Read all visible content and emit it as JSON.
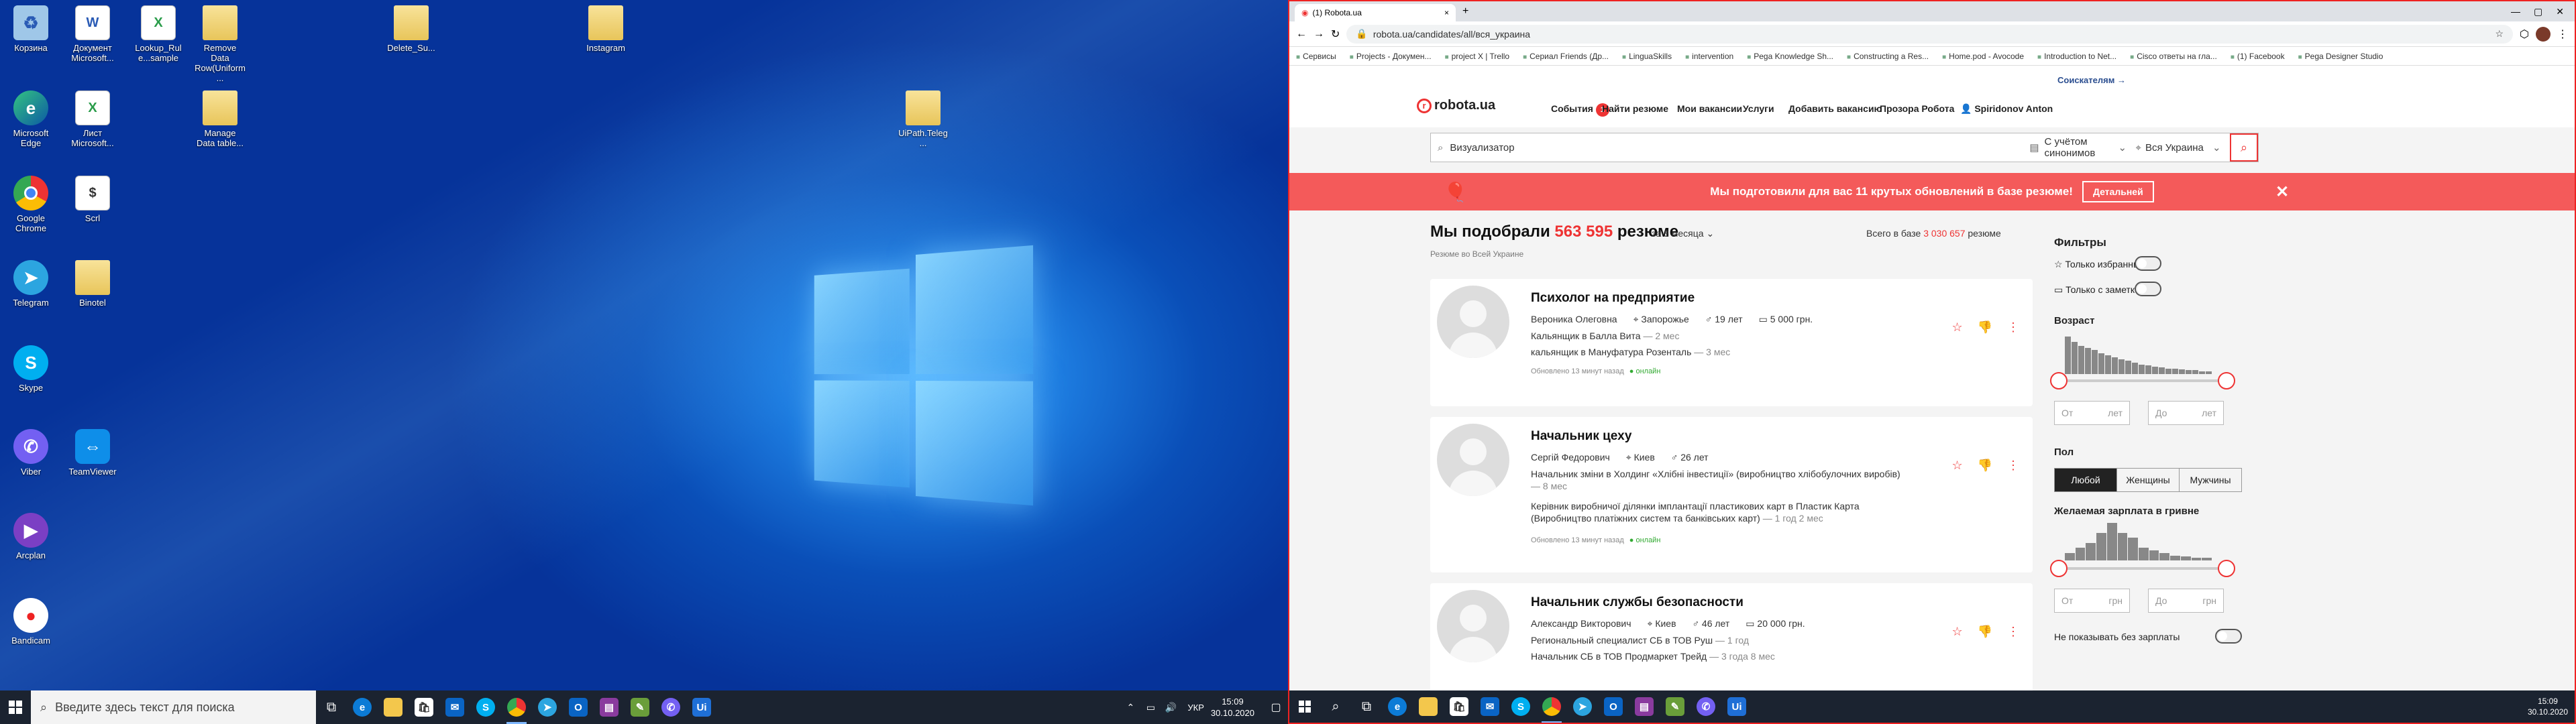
{
  "desktop": {
    "icons": [
      {
        "label": "Корзина",
        "type": "recycle"
      },
      {
        "label": "Документ Microsoft...",
        "type": "doc"
      },
      {
        "label": "Lookup_Rule...sample",
        "type": "doc"
      },
      {
        "label": "Remove Data Row(Uniform...",
        "type": "folder"
      },
      {
        "label": "Delete_Su...",
        "type": "folder"
      },
      {
        "label": "Instagram",
        "type": "folder"
      },
      {
        "label": "Microsoft Edge",
        "type": "edge"
      },
      {
        "label": "Лист Microsoft...",
        "type": "doc"
      },
      {
        "label": "Manage Data table...",
        "type": "folder"
      },
      {
        "label": "UiPath.Teleg...",
        "type": "folder"
      },
      {
        "label": "Google Chrome",
        "type": "chrome"
      },
      {
        "label": "Scrl",
        "type": "doc"
      },
      {
        "label": "Telegram",
        "type": "telegram"
      },
      {
        "label": "Binotel",
        "type": "folder"
      },
      {
        "label": "Skype",
        "type": "skype"
      },
      {
        "label": "Viber",
        "type": "viber"
      },
      {
        "label": "TeamViewer",
        "type": "teamviewer"
      },
      {
        "label": "Arcplan",
        "type": "app"
      },
      {
        "label": "Bandicam",
        "type": "bandicam"
      }
    ]
  },
  "taskbar": {
    "search_placeholder": "Введите здесь текст для поиска",
    "lang": "УКР",
    "time": "15:09",
    "date": "30.10.2020"
  },
  "browser": {
    "tab_title": "(1) Robota.ua",
    "url": "robota.ua/candidates/all/вся_украина",
    "bookmarks": [
      "Сервисы",
      "Projects - Докумен...",
      "project X | Trello",
      "Сериал Friends (Др...",
      "LinguaSkills",
      "intervention",
      "Pega Knowledge Sh...",
      "Constructing a Res...",
      "Home.pod - Avocode",
      "Introduction to Net...",
      "Cisco ответы на гла...",
      "(1) Facebook",
      "Pega Designer Studio"
    ]
  },
  "site": {
    "soiskatelyam": "Соискателям →",
    "logo": "robota.ua",
    "events_label": "События",
    "events_count": "1",
    "menu": [
      "Найти резюме",
      "Мои вакансии",
      "Услуги",
      "Добавить вакансию",
      "Прозора Робота"
    ],
    "user": "Spiridonov Anton",
    "search_value": "Визуализатор",
    "synonyms": "С учётом синонимов",
    "region": "Вся Украина",
    "banner_text": "Мы подготовили для вас 11 крутых обновлений в базе резюме!",
    "banner_button": "Детальней",
    "found_prefix": "Мы подобрали",
    "found_count": "563 595",
    "found_suffix": "резюме",
    "period": "за 3 месяца",
    "region_note": "Резюме во Всей Украине",
    "total_prefix": "Всего в базе",
    "total_count": "3 030 657",
    "total_suffix": "резюме",
    "cards": [
      {
        "title": "Психолог на предприятие",
        "name": "Вероника Олеговна",
        "city": "Запорожье",
        "age": "19 лет",
        "salary": "5 000 грн.",
        "lines": [
          {
            "text": "Кальянщик в Балла Вита",
            "dur": "— 2 мес"
          },
          {
            "text": "кальянщик в Мануфатура Розенталь",
            "dur": "— 3 мес"
          }
        ],
        "updated": "Обновлено 13 минут назад",
        "status": "онлайн"
      },
      {
        "title": "Начальник цеху",
        "name": "Сергій Федорович",
        "city": "Киев",
        "age": "26 лет",
        "salary": "",
        "lines": [
          {
            "text": "Начальник зміни в Холдинг «Хлібні інвестиції» (виробництво хлібобулочних виробів)",
            "dur": "— 8 мес"
          },
          {
            "text": "Керівник виробничої ділянки імплантації пластикових карт в Пластик Карта (Виробництво платіжних систем та банківських карт)",
            "dur": "— 1 год 2 мес"
          }
        ],
        "updated": "Обновлено 13 минут назад",
        "status": "онлайн"
      },
      {
        "title": "Начальник службы безопасности",
        "name": "Александр Викторович",
        "city": "Киев",
        "age": "46 лет",
        "salary": "20 000 грн.",
        "lines": [
          {
            "text": "Региональный специалист СБ в ТОВ Руш",
            "dur": "— 1 год"
          },
          {
            "text": "Начальник СБ в ТОВ Продмаркет Трейд",
            "dur": "— 3 года 8 мес"
          }
        ],
        "updated": "",
        "status": ""
      }
    ],
    "filters": {
      "title": "Фильтры",
      "only_favorites": "Только избранные",
      "only_notes": "Только с заметками",
      "age_title": "Возраст",
      "age_hist": [
        40,
        34,
        30,
        28,
        26,
        22,
        20,
        18,
        16,
        14,
        12,
        10,
        9,
        8,
        7,
        6,
        6,
        5,
        4,
        4,
        3,
        3
      ],
      "from": "От",
      "to": "До",
      "years": "лет",
      "gender_title": "Пол",
      "gender": [
        "Любой",
        "Женщины",
        "Мужчины"
      ],
      "salary_title": "Желаемая зарплата в гривне",
      "salary_hist": [
        6,
        10,
        14,
        22,
        30,
        22,
        18,
        10,
        8,
        6,
        4,
        3,
        2,
        2
      ],
      "currency": "грн",
      "hide_no_salary": "Не показывать без зарплаты"
    }
  },
  "colors": {
    "accent": "#e33333",
    "banner": "#f45a5a",
    "desktop": "#0a4fb8"
  }
}
